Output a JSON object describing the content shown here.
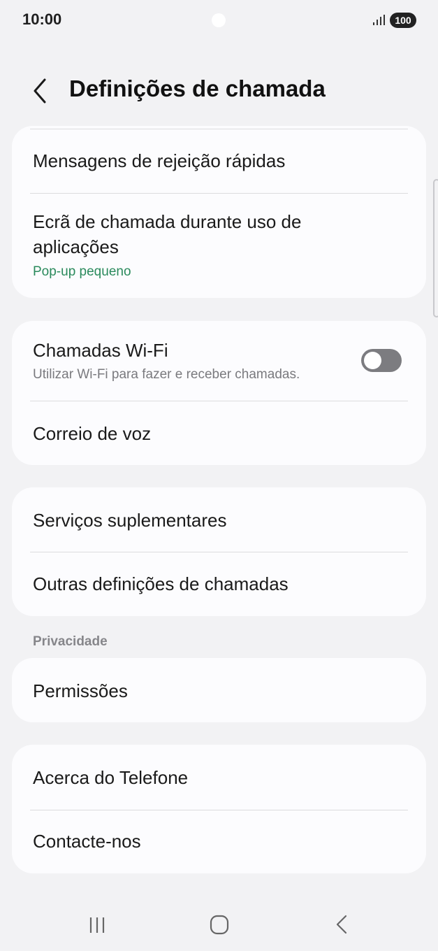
{
  "status_bar": {
    "time": "10:00",
    "battery": "100"
  },
  "header": {
    "title": "Definições de chamada"
  },
  "groups": [
    {
      "items": [
        {
          "title": "Mensagens de rejeição rápidas"
        },
        {
          "title_line1": "Ecrã de chamada durante uso de",
          "title_line2": "aplicações",
          "subtitle": "Pop-up pequeno"
        }
      ]
    },
    {
      "items": [
        {
          "title": "Chamadas Wi-Fi",
          "subtitle": "Utilizar Wi-Fi para fazer e receber chamadas.",
          "toggle": false
        },
        {
          "title": "Correio de voz"
        }
      ]
    },
    {
      "items": [
        {
          "title": "Serviços suplementares"
        },
        {
          "title": "Outras definições de chamadas"
        }
      ]
    },
    {
      "label": "Privacidade",
      "items": [
        {
          "title": "Permissões"
        }
      ]
    },
    {
      "items": [
        {
          "title": "Acerca do Telefone"
        },
        {
          "title": "Contacte-nos"
        }
      ]
    }
  ],
  "colors": {
    "background": "#f2f2f4",
    "card": "#fcfcfe",
    "accent_green": "#2a8a5c",
    "toggle_off": "#7c7c80"
  },
  "icons": {
    "back": "chevron-left-icon",
    "nav_recents": "recents-icon",
    "nav_home": "home-icon",
    "nav_back": "back-icon"
  }
}
